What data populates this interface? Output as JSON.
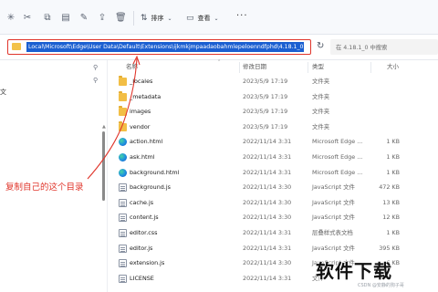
{
  "toolbar": {
    "sort_label": "排序",
    "view_label": "查看",
    "more_label": "···"
  },
  "address": {
    "path": "Local\\Microsoft\\Edge\\User Data\\Default\\Extensions\\ijkmkjmpaadaobahmlepeloenndfphd\\4.18.1_0",
    "search_placeholder": "在 4.18.1_0 中搜索"
  },
  "leftnav": {
    "partial_label": "文"
  },
  "columns": {
    "name": "名称",
    "date": "修改日期",
    "type": "类型",
    "size": "大小"
  },
  "files": [
    {
      "icon": "folder-icon",
      "name": "_locales",
      "date": "2023/5/9 17:19",
      "type": "文件夹",
      "size": ""
    },
    {
      "icon": "folder-icon",
      "name": "_metadata",
      "date": "2023/5/9 17:19",
      "type": "文件夹",
      "size": ""
    },
    {
      "icon": "folder-icon",
      "name": "images",
      "date": "2023/5/9 17:19",
      "type": "文件夹",
      "size": ""
    },
    {
      "icon": "folder-icon",
      "name": "vendor",
      "date": "2023/5/9 17:19",
      "type": "文件夹",
      "size": ""
    },
    {
      "icon": "edge-html-icon",
      "name": "action.html",
      "date": "2022/11/14 3:31",
      "type": "Microsoft Edge ...",
      "size": "1 KB"
    },
    {
      "icon": "edge-html-icon",
      "name": "ask.html",
      "date": "2022/11/14 3:31",
      "type": "Microsoft Edge ...",
      "size": "1 KB"
    },
    {
      "icon": "edge-html-icon",
      "name": "background.html",
      "date": "2022/11/14 3:31",
      "type": "Microsoft Edge ...",
      "size": "1 KB"
    },
    {
      "icon": "js-file-icon",
      "name": "background.js",
      "date": "2022/11/14 3:30",
      "type": "JavaScript 文件",
      "size": "472 KB"
    },
    {
      "icon": "js-file-icon",
      "name": "cache.js",
      "date": "2022/11/14 3:30",
      "type": "JavaScript 文件",
      "size": "13 KB"
    },
    {
      "icon": "js-file-icon",
      "name": "content.js",
      "date": "2022/11/14 3:30",
      "type": "JavaScript 文件",
      "size": "12 KB"
    },
    {
      "icon": "css-file-icon",
      "name": "editor.css",
      "date": "2022/11/14 3:31",
      "type": "层叠样式表文档",
      "size": "1 KB"
    },
    {
      "icon": "js-file-icon",
      "name": "editor.js",
      "date": "2022/11/14 3:31",
      "type": "JavaScript 文件",
      "size": "395 KB"
    },
    {
      "icon": "js-file-icon",
      "name": "extension.js",
      "date": "2022/11/14 3:30",
      "type": "JavaScript 文件",
      "size": "6 KB"
    },
    {
      "icon": "file-icon",
      "name": "LICENSE",
      "date": "2022/11/14 3:31",
      "type": "文件",
      "size": ""
    }
  ],
  "annotation": {
    "text": "复制自己的这个目录",
    "color": "#e0352b"
  },
  "watermark": {
    "main": "软件下载",
    "sub": "CSDN @安静的狗子哥"
  },
  "colors": {
    "highlight": "#1b5fd1",
    "annotation": "#e0352b",
    "folder": "#f2be45"
  }
}
